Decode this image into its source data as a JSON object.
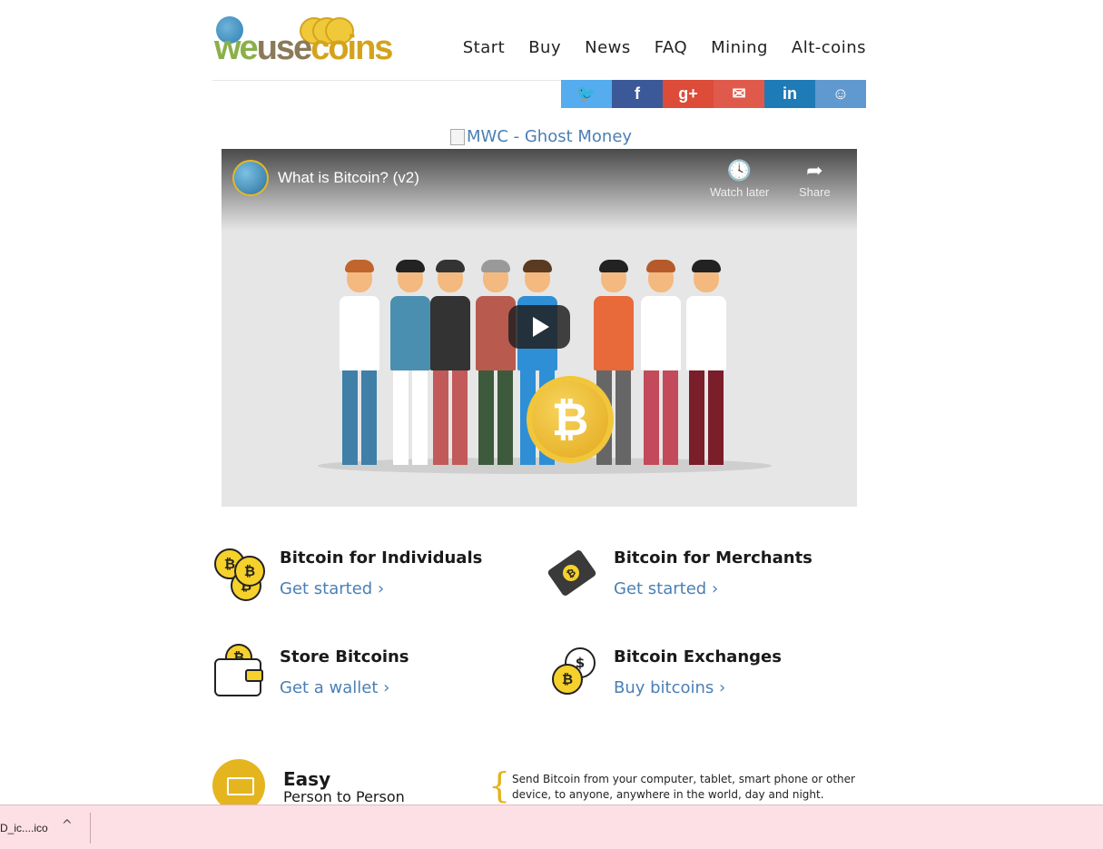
{
  "logo": {
    "we": "we",
    "use": "use",
    "coins": "coins"
  },
  "nav": [
    "Start",
    "Buy",
    "News",
    "FAQ",
    "Mining",
    "Alt-coins"
  ],
  "share": [
    {
      "name": "twitter",
      "glyph": "🐦",
      "color": "#55acee"
    },
    {
      "name": "facebook",
      "glyph": "f",
      "color": "#3b5998"
    },
    {
      "name": "google-plus",
      "glyph": "g+",
      "color": "#dd4b39"
    },
    {
      "name": "email",
      "glyph": "✉",
      "color": "#e05a4c"
    },
    {
      "name": "linkedin",
      "glyph": "in",
      "color": "#1f7bb6"
    },
    {
      "name": "reddit",
      "glyph": "☺",
      "color": "#5f99cf"
    }
  ],
  "banner_alt": "MWC - Ghost Money",
  "video": {
    "title": "What is Bitcoin? (v2)",
    "watch_later": "Watch later",
    "share": "Share"
  },
  "features": [
    {
      "title": "Bitcoin for Individuals",
      "link": "Get started ›"
    },
    {
      "title": "Bitcoin for Merchants",
      "link": "Get started ›"
    },
    {
      "title": "Store Bitcoins",
      "link": "Get a wallet ›"
    },
    {
      "title": "Bitcoin Exchanges",
      "link": "Buy bitcoins ›"
    }
  ],
  "easy": {
    "title": "Easy",
    "subtitle": "Person to Person",
    "description": "Send Bitcoin from your computer, tablet, smart phone or other device, to anyone, anywhere in the world, day and night."
  },
  "download_bar": {
    "file": "D_ic....ico",
    "chevron": "^"
  }
}
